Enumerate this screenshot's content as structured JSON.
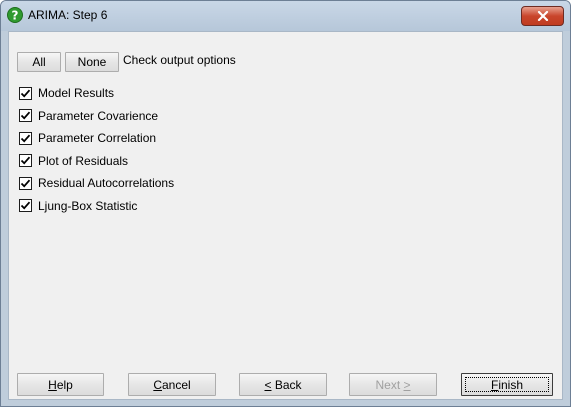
{
  "window": {
    "title": "ARIMA: Step 6"
  },
  "toolbar": {
    "all_label": "All",
    "none_label": "None",
    "hint": "Check output options"
  },
  "options": [
    {
      "label": "Model Results",
      "checked": true
    },
    {
      "label": "Parameter Covarience",
      "checked": true
    },
    {
      "label": "Parameter Correlation",
      "checked": true
    },
    {
      "label": "Plot of Residuals",
      "checked": true
    },
    {
      "label": "Residual Autocorrelations",
      "checked": true
    },
    {
      "label": "Ljung-Box Statistic",
      "checked": true
    }
  ],
  "buttons": {
    "help": {
      "label_pre": "",
      "accel": "H",
      "label_post": "elp",
      "enabled": true
    },
    "cancel": {
      "label_pre": "",
      "accel": "C",
      "label_post": "ancel",
      "enabled": true
    },
    "back": {
      "label_pre": "",
      "accel": "<",
      "label_post": " Back",
      "enabled": true
    },
    "next": {
      "label_pre": "Next ",
      "accel": ">",
      "label_post": "",
      "enabled": false
    },
    "finish": {
      "label_pre": "",
      "accel": "F",
      "label_post": "inish",
      "enabled": true
    }
  },
  "icons": {
    "title": "help-question-icon",
    "close": "close-icon",
    "check": "checkmark-icon"
  },
  "colors": {
    "titlebar": "#bfcddb",
    "client": "#f0f0f0",
    "close_button": "#c9462c",
    "help_icon": "#3aa33a"
  }
}
